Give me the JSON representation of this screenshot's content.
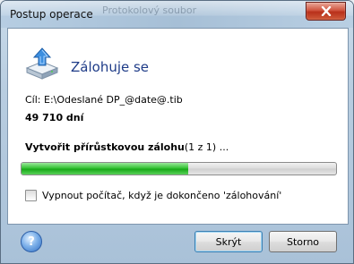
{
  "window": {
    "title": "Postup operace",
    "background_title": "Protokolový soubor"
  },
  "header": {
    "title": "Zálohuje se",
    "icon": "backup-drive-upload-icon"
  },
  "details": {
    "destination": "Cíl: E:\\Odeslané DP_@date@.tib",
    "days": "49 710 dní"
  },
  "operation": {
    "label": "Vytvořit přírůstkovou zálohu",
    "counter": "(1 z 1) ..."
  },
  "progress": {
    "fraction": 0.53,
    "color": "#22b422"
  },
  "checkbox": {
    "label": "Vypnout počítač, když je dokončeno 'zálohování'",
    "checked": false
  },
  "buttons": {
    "hide": "Skrýt",
    "cancel": "Storno"
  },
  "colors": {
    "title_blue": "#1f3c88",
    "progress_green": "#22b422",
    "close_red": "#c8402a"
  }
}
